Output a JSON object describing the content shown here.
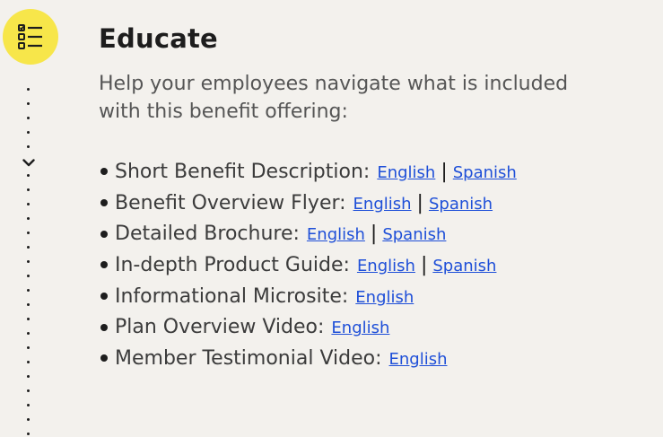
{
  "section": {
    "title": "Educate",
    "intro_line1": "Help your employees navigate what is included",
    "intro_line2": "with this benefit offering:"
  },
  "icons": {
    "header": "checklist-icon",
    "timeline": "chevron-down-icon"
  },
  "colors": {
    "icon_bg": "#f7e64a",
    "link": "#1e4fd8",
    "page_bg": "#f3f1ed"
  },
  "items": [
    {
      "label": "Short Benefit Description:",
      "links": [
        "English",
        "Spanish"
      ],
      "separator": "|"
    },
    {
      "label": "Benefit Overview Flyer:",
      "links": [
        "English",
        "Spanish"
      ],
      "separator": "|"
    },
    {
      "label": "Detailed Brochure:",
      "links": [
        "English",
        "Spanish"
      ],
      "separator": "|"
    },
    {
      "label": "In-depth Product Guide:",
      "links": [
        "English",
        "Spanish"
      ],
      "separator": "|"
    },
    {
      "label": "Informational Microsite:",
      "links": [
        "English"
      ]
    },
    {
      "label": "Plan Overview Video:",
      "links": [
        "English"
      ]
    },
    {
      "label": "Member Testimonial Video:",
      "links": [
        "English"
      ]
    }
  ]
}
